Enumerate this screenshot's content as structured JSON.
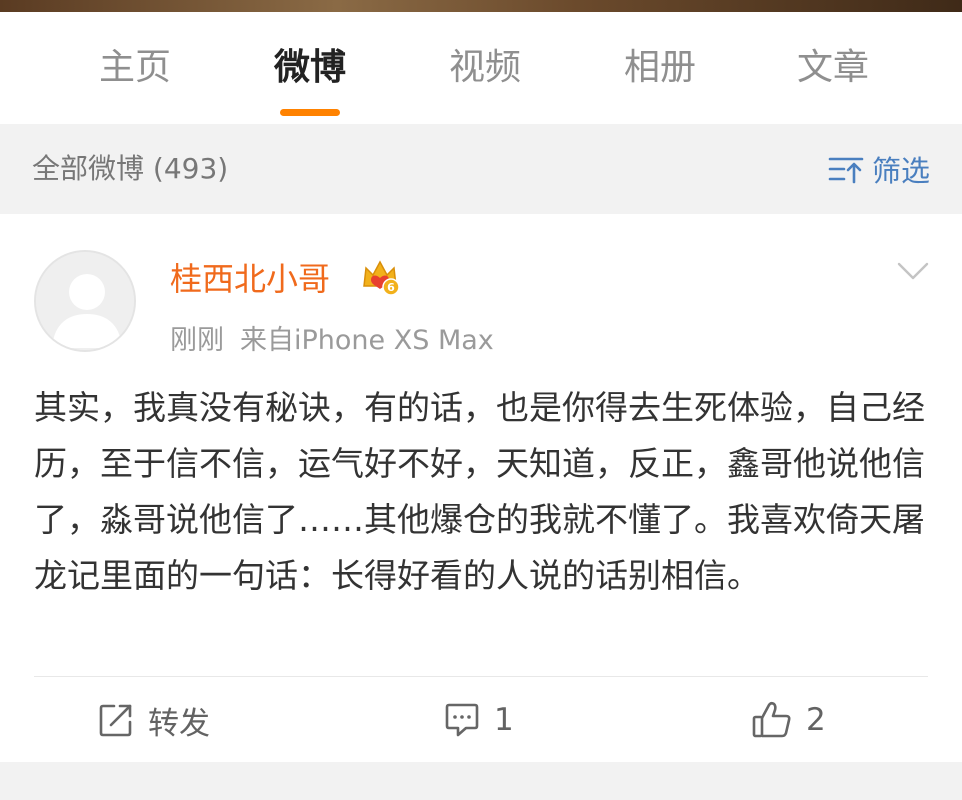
{
  "tabs": [
    {
      "label": "主页",
      "active": false
    },
    {
      "label": "微博",
      "active": true
    },
    {
      "label": "视频",
      "active": false
    },
    {
      "label": "相册",
      "active": false
    },
    {
      "label": "文章",
      "active": false
    }
  ],
  "filter": {
    "title": "全部微博 (493)",
    "button_label": "筛选",
    "icon": "filter-sort-icon"
  },
  "post": {
    "username": "桂西北小哥",
    "vip_level": "6",
    "time": "刚刚",
    "source": "来自iPhone XS Max",
    "content": "其实，我真没有秘诀，有的话，也是你得去生死体验，自己经历，至于信不信，运气好不好，天知道，反正，鑫哥他说他信了，淼哥说他信了……其他爆仓的我就不懂了。我喜欢倚天屠龙记里面的一句话：长得好看的人说的话别相信。",
    "actions": {
      "repost_label": "转发",
      "comment_count": "1",
      "like_count": "2"
    }
  },
  "colors": {
    "accent": "#ff8200",
    "username": "#f06a1c",
    "link_blue": "#4a7fbf",
    "vip_gold": "#f2b11b",
    "vip_red": "#e8402e"
  }
}
